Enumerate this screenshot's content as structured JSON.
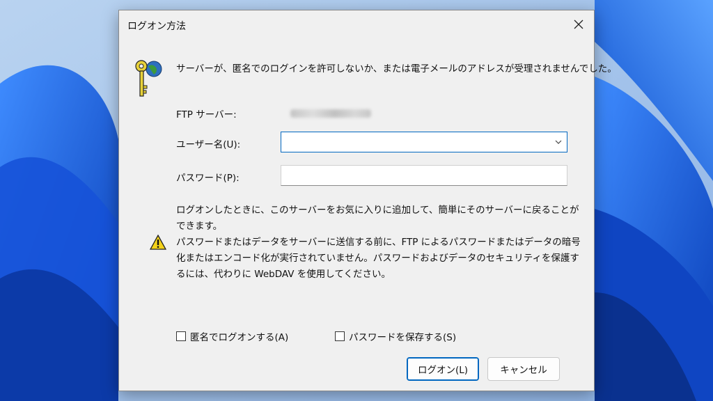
{
  "dialog": {
    "title": "ログオン方法",
    "message": "サーバーが、匿名でのログインを許可しないか、または電子メールのアドレスが受理されませんでした。",
    "ftp_server_label": "FTP サーバー:",
    "username_label": "ユーザー名(U):",
    "username_value": "",
    "password_label": "パスワード(P):",
    "password_value": "",
    "notice_1": "ログオンしたときに、このサーバーをお気に入りに追加して、簡単にそのサーバーに戻ることができます。",
    "notice_2": "パスワードまたはデータをサーバーに送信する前に、FTP によるパスワードまたはデータの暗号化またはエンコード化が実行されていません。パスワードおよびデータのセキュリティを保護するには、代わりに WebDAV を使用してください。",
    "anonymous_label": "匿名でログオンする(A)",
    "anonymous_checked": false,
    "save_password_label": "パスワードを保存する(S)",
    "save_password_checked": false,
    "logon_button": "ログオン(L)",
    "cancel_button": "キャンセル"
  },
  "icons": {
    "close": "close-icon",
    "keys": "keys-globe-icon",
    "warning": "warning-icon",
    "dropdown": "chevron-down-icon"
  },
  "colors": {
    "accent": "#0067c0",
    "dialog_bg": "#f0f0f0",
    "desktop": "#1e5fd6"
  }
}
